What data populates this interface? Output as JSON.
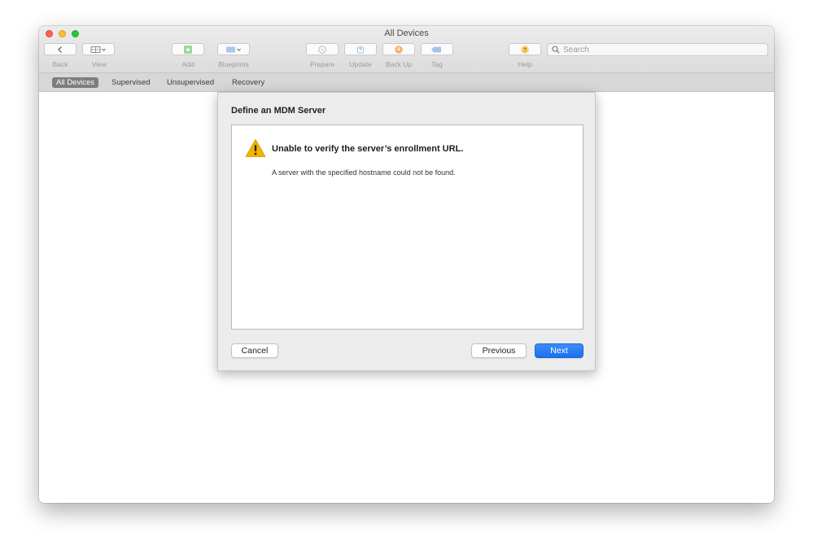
{
  "window": {
    "title": "All Devices"
  },
  "toolbar": {
    "back_label": "Back",
    "view_label": "View",
    "add_label": "Add",
    "blueprints_label": "Blueprints",
    "prepare_label": "Prepare",
    "update_label": "Update",
    "backup_label": "Back Up",
    "tag_label": "Tag",
    "help_label": "Help",
    "search_placeholder": "Search"
  },
  "scope_bar": {
    "items": [
      {
        "label": "All Devices",
        "active": true
      },
      {
        "label": "Supervised",
        "active": false
      },
      {
        "label": "Unsupervised",
        "active": false
      },
      {
        "label": "Recovery",
        "active": false
      }
    ]
  },
  "sheet": {
    "title": "Define an MDM Server",
    "error_title": "Unable to verify the server’s enrollment URL.",
    "error_message": "A server with the specified hostname could not be found.",
    "cancel_label": "Cancel",
    "previous_label": "Previous",
    "next_label": "Next"
  },
  "colors": {
    "accent": "#1a6ff0",
    "warning": "#f2b400",
    "close": "#ff5f57",
    "minimize": "#febc2e",
    "zoom": "#28c840"
  }
}
